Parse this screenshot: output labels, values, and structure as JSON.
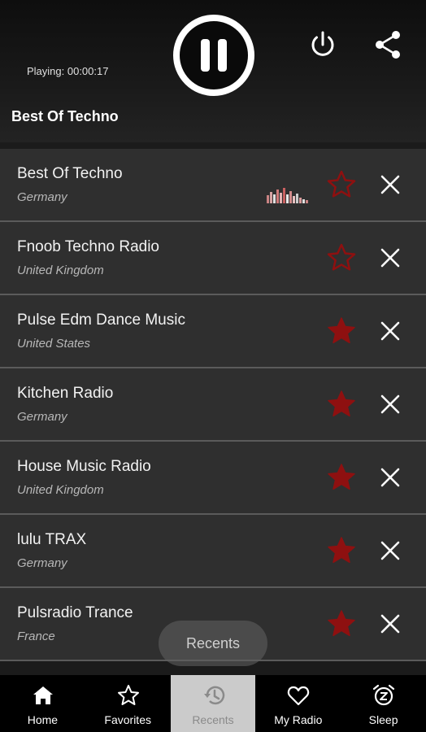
{
  "header": {
    "playing_text": "Playing: 00:00:17",
    "station_title": "Best Of Techno"
  },
  "stations": [
    {
      "name": "Best Of Techno",
      "country": "Germany",
      "favorite": false,
      "now_playing": true
    },
    {
      "name": "Fnoob Techno Radio",
      "country": "United Kingdom",
      "favorite": false,
      "now_playing": false
    },
    {
      "name": "Pulse Edm Dance Music",
      "country": "United States",
      "favorite": true,
      "now_playing": false
    },
    {
      "name": "Kitchen Radio",
      "country": "Germany",
      "favorite": true,
      "now_playing": false
    },
    {
      "name": "House Music Radio",
      "country": "United Kingdom",
      "favorite": true,
      "now_playing": false
    },
    {
      "name": "lulu TRAX",
      "country": "Germany",
      "favorite": true,
      "now_playing": false
    },
    {
      "name": "Pulsradio Trance",
      "country": "France",
      "favorite": true,
      "now_playing": false
    }
  ],
  "toast": "Recents",
  "nav": {
    "items": [
      {
        "label": "Home",
        "icon": "home-icon"
      },
      {
        "label": "Favorites",
        "icon": "star-outline-icon"
      },
      {
        "label": "Recents",
        "icon": "history-icon"
      },
      {
        "label": "My Radio",
        "icon": "heart-icon"
      },
      {
        "label": "Sleep",
        "icon": "alarm-z-icon"
      }
    ],
    "active_index": 2
  },
  "colors": {
    "favorite_star": "#8e1010",
    "background": "#1b1b1b",
    "row": "#2f2f2f",
    "active_tab": "#cbcbcb"
  }
}
